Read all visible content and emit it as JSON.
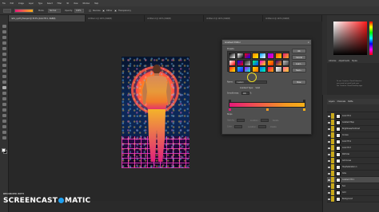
{
  "menu": {
    "items": [
      "File",
      "Edit",
      "Image",
      "Layer",
      "Type",
      "Select",
      "Filter",
      "3D",
      "View",
      "Window",
      "Help"
    ]
  },
  "options": {
    "mode_label": "Mode:",
    "mode_value": "Normal",
    "opacity_label": "Opacity:",
    "opacity_value": "100%",
    "reverse_label": "Reverse",
    "dither_label": "Dither",
    "transparency_label": "Transparency"
  },
  "document_tabs": [
    {
      "label": "retro_synth_final.psd @ 33.3% (Color Fill 1, RGB/8)",
      "active": true
    },
    {
      "label": "Untitled-1 @ 100% (RGB/8)",
      "active": false
    },
    {
      "label": "Untitled-2 @ 100% (RGB/8)",
      "active": false
    },
    {
      "label": "Untitled-3 @ 100% (RGB/8)",
      "active": false
    },
    {
      "label": "Untitled-4 @ 100% (RGB/8)",
      "active": false
    }
  ],
  "dialog": {
    "title": "Gradient Editor",
    "close_glyph": "×",
    "presets_label": "Presets",
    "buttons": {
      "ok": "OK",
      "cancel": "Cancel",
      "load": "Load...",
      "save": "Save..."
    },
    "name_label": "Name:",
    "name_value": "Custom",
    "new_label": "New",
    "gradient_type_label": "Gradient Type:",
    "gradient_type_value": "Solid",
    "smoothness_label": "Smoothness:",
    "smoothness_value": "100",
    "smoothness_unit": "%",
    "stops_label": "Stops",
    "stop_fields": {
      "opacity_label": "Opacity:",
      "location_label": "Location:",
      "delete_label": "Delete",
      "color_label": "Color:"
    },
    "preset_colors": [
      [
        "#000000",
        "#ffffff"
      ],
      [
        "#ffffff",
        "#000000"
      ],
      [
        "#ff0000",
        "#0000ff"
      ],
      [
        "#ff8a00",
        "#ffe800"
      ],
      [
        "#00a0ff",
        "#ffffff"
      ],
      [
        "#8a00ff",
        "#ff00a8"
      ],
      [
        "#ff5a00",
        "#ffd100"
      ],
      [
        "#e6197a",
        "#f7b018"
      ],
      [
        "#ffffff",
        "#ff0000"
      ],
      [
        "#0000ff",
        "#ff0000"
      ],
      [
        "#222222",
        "#c0c0c0"
      ],
      [
        "#00ff7a",
        "#0040ff"
      ],
      [
        "#ff00d4",
        "#ffe000"
      ],
      [
        "#ffb000",
        "#ff2a00"
      ],
      [
        "#3a0080",
        "#ff9a00"
      ],
      [
        "#c0c0c0",
        "#404040"
      ],
      [
        "#ff2222",
        "#ffee00"
      ],
      [
        "#00d0ff",
        "#3300ff"
      ],
      [
        "#b000ff",
        "#00ffd0"
      ],
      [
        "#ffdd00",
        "#ff6600"
      ],
      [
        "#0066ff",
        "#00ffaa"
      ],
      [
        "#ff0066",
        "#ffaa00"
      ],
      [
        "#ffffff",
        "#888888"
      ],
      [
        "#ff6699",
        "#ffcc33"
      ]
    ],
    "gradient_colors": {
      "start": "#e6197a",
      "end": "#f7b018"
    }
  },
  "right_panel": {
    "tabs": [
      "Libraries",
      "Adjustments",
      "Styles"
    ],
    "message_lines": [
      "To use Creative Cloud Libraries,",
      "you need to install and sync",
      "the Creative Cloud Desktop app."
    ],
    "layers_tabs": [
      "Layers",
      "Channels",
      "Paths"
    ],
    "layers": [
      {
        "name": "Color Fill 1",
        "selected": false
      },
      {
        "name": "Gradient Map",
        "selected": false
      },
      {
        "name": "Brightness/Contrast",
        "selected": false
      },
      {
        "name": "Curves",
        "selected": false
      },
      {
        "name": "Color Fill 2",
        "selected": false
      },
      {
        "name": "Color Fill 3",
        "selected": false
      },
      {
        "name": "Particles",
        "selected": false
      },
      {
        "name": "Grid Lines",
        "selected": false
      },
      {
        "name": "Hue/Saturation 1",
        "selected": false
      },
      {
        "name": "Glow",
        "selected": false
      },
      {
        "name": "Gradient Fill 1",
        "selected": true
      },
      {
        "name": "Sun",
        "selected": false
      },
      {
        "name": "Grid",
        "selected": false
      },
      {
        "name": "Background",
        "selected": false
      }
    ]
  },
  "watermark": {
    "recorded_with": "RECORDED WITH",
    "brand_left": "SCREENCAST",
    "brand_right": "MATIC"
  },
  "colors": {
    "accent_yellow": "#f2e22a",
    "layer_tag": "#c9a91a",
    "watermark_blue": "#1ea0f1"
  }
}
